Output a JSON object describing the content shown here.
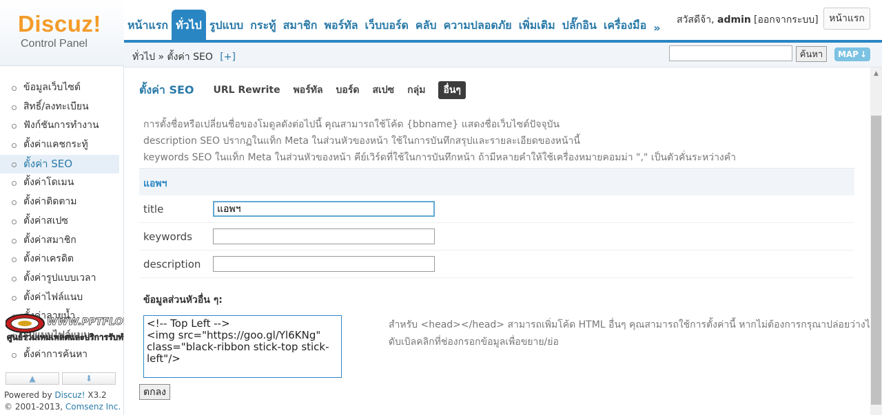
{
  "logo": {
    "title": "Discuz!",
    "subtitle": "Control Panel"
  },
  "topnav": {
    "items": [
      {
        "label": "หน้าแรก",
        "active": false
      },
      {
        "label": "ทั่วไป",
        "active": true
      },
      {
        "label": "รูปแบบ",
        "active": false
      },
      {
        "label": "กระทู้",
        "active": false
      },
      {
        "label": "สมาชิก",
        "active": false
      },
      {
        "label": "พอร์ทัล",
        "active": false
      },
      {
        "label": "เว็บบอร์ด",
        "active": false
      },
      {
        "label": "คลับ",
        "active": false
      },
      {
        "label": "ความปลอดภัย",
        "active": false
      },
      {
        "label": "เพิ่มเติม",
        "active": false
      },
      {
        "label": "ปลั๊กอิน",
        "active": false
      },
      {
        "label": "เครื่องมือ",
        "active": false
      },
      {
        "label": "»",
        "active": false
      }
    ]
  },
  "user": {
    "greeting": "สวัสดีจ้า,",
    "name": "admin",
    "logout": "[ออกจากระบบ]",
    "home_button": "หน้าแรก"
  },
  "breadcrumb": {
    "text": "ทั่วไป » ตั้งค่า SEO",
    "plus": "[+]"
  },
  "search": {
    "value": "",
    "button": "ค้นหา",
    "map_button": "MAP"
  },
  "sidebar": {
    "items": [
      {
        "label": "ข้อมูลเว็บไซต์"
      },
      {
        "label": "สิทธิ์/ลงทะเบียน"
      },
      {
        "label": "ฟังก์ชันการทำงาน"
      },
      {
        "label": "ตั้งค่าแคชกระทู้"
      },
      {
        "label": "ตั้งค่า SEO"
      },
      {
        "label": "ตั้งค่าโดเมน"
      },
      {
        "label": "ตั้งค่าติดตาม"
      },
      {
        "label": "ตั้งค่าสเปซ"
      },
      {
        "label": "ตั้งค่าสมาชิก"
      },
      {
        "label": "ตั้งค่าเครดิต"
      },
      {
        "label": "ตั้งค่ารูปแบบเวลา"
      },
      {
        "label": "ตั้งค่าไฟล์แนบ"
      },
      {
        "label": "ตั้งค่าลายน้ำ"
      },
      {
        "label": "รูปแบบไฟล์แนบ"
      },
      {
        "label": "ตั้งค่าการค้นหา"
      }
    ],
    "active_index": 4
  },
  "footer": {
    "powered_prefix": "Powered by",
    "powered_link": "Discuz!",
    "version": "X3.2",
    "copyright_prefix": "© 2001-2013,",
    "copyright_link": "Comsenz Inc."
  },
  "watermark": {
    "line1": "WWW.PPTFLOWER.COM",
    "line2": "ศูนย์รวมเทมเพลตและบริการรับทำเว็บ"
  },
  "tabs": {
    "title": "ตั้งค่า SEO",
    "items": [
      {
        "label": "URL Rewrite",
        "active": false
      },
      {
        "label": "พอร์ทัล",
        "active": false
      },
      {
        "label": "บอร์ด",
        "active": false
      },
      {
        "label": "สเปซ",
        "active": false
      },
      {
        "label": "กลุ่ม",
        "active": false
      },
      {
        "label": "อื่นๆ",
        "active": true
      }
    ]
  },
  "hints": [
    "การตั้งชื่อหรือเปลี่ยนชื่อของโมดูลดังต่อไปนี้ คุณสามารถใช้โค้ด {bbname} แสดงชื่อเว็บไซต์ปัจจุบัน",
    "description SEO ปรากฏในแท็ก Meta ในส่วนหัวของหน้า ใช้ในการบันทึกสรุปและรายละเอียดของหน้านี้",
    "keywords SEO ในแท็ก Meta ในส่วนหัวของหน้า คีย์เวิร์ดที่ใช้ในการบันทึกหน้า ถ้ามีหลายคำให้ใช้เครื่องหมายคอมม่า \",\" เป็นตัวคั่นระหว่างคำ"
  ],
  "section": {
    "title": "แอพฯ"
  },
  "form": {
    "title": {
      "label": "title",
      "value": "แอพฯ"
    },
    "keywords": {
      "label": "keywords",
      "value": ""
    },
    "description": {
      "label": "description",
      "value": ""
    }
  },
  "extra": {
    "label": "ข้อมูลส่วนหัวอื่น ๆ:",
    "value": "<!-- Top Left -->\n<img src=\"https://goo.gl/Yl6KNg\" class=\"black-ribbon stick-top stick-left\"/>",
    "hint1": "สำหรับ <head></head> สามารถเพิ่มโค้ด HTML อื่นๆ คุณสามารถใช้การตั้งค่านี้ หากไม่ต้องการกรุณาปล่อยว่างไว้",
    "hint2": "ดับเบิลคลิกที่ช่องกรอกข้อมูลเพื่อขยาย/ย่อ"
  },
  "submit": {
    "label": "ตกลง"
  }
}
